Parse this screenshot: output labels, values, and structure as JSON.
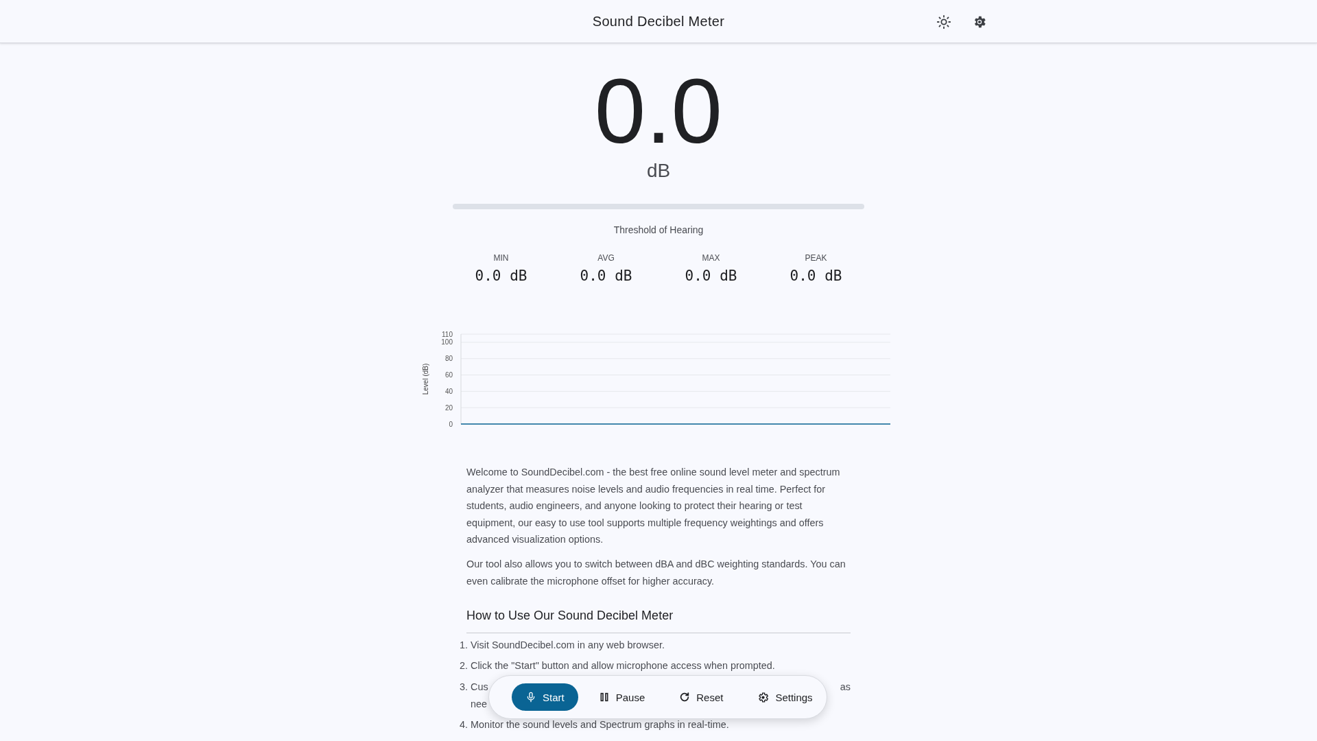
{
  "header": {
    "title": "Sound Decibel Meter"
  },
  "meter": {
    "value": "0.0",
    "unit": "dB",
    "level": 0,
    "description": "Threshold of Hearing"
  },
  "stats": [
    {
      "label": "MIN",
      "value": "0.0 dB"
    },
    {
      "label": "AVG",
      "value": "0.0 dB"
    },
    {
      "label": "MAX",
      "value": "0.0 dB"
    },
    {
      "label": "PEAK",
      "value": "0.0 dB"
    }
  ],
  "chart": {
    "chart_data": {
      "type": "line",
      "grid": true,
      "ylabel": "Level (dB)",
      "ylim": [
        0,
        110
      ],
      "yticks": [
        0,
        20,
        40,
        60,
        80,
        100,
        110
      ],
      "series": [
        {
          "color": "#0a6494",
          "values": [
            0,
            0,
            0,
            0,
            0,
            0,
            0,
            0,
            0,
            0,
            0,
            0,
            0,
            0,
            0,
            0,
            0,
            0,
            0,
            0
          ]
        }
      ]
    }
  },
  "intro": [
    "Welcome to SoundDecibel.com - the best free online sound level meter and spectrum analyzer that measures noise levels and audio frequencies in real time. Perfect for students, audio engineers, and anyone looking to protect their hearing or test equipment, our easy to use tool supports multiple frequency weightings and offers advanced visualization options.",
    "Our tool also allows you to switch between dBA and dBC weighting standards. You can even calibrate the microphone offset for higher accuracy."
  ],
  "how_to": {
    "heading": "How to Use Our Sound Decibel Meter",
    "steps": [
      {
        "number": "1.",
        "text": "Visit SoundDecibel.com in any web browser."
      },
      {
        "number": "2.",
        "text": "Click the \"Start\" button and allow microphone access when prompted."
      },
      {
        "number": "3.",
        "text": "Cus",
        "text_end": "as",
        "text_line2": "nee"
      },
      {
        "number": "4.",
        "text": "Monitor the sound levels and Spectrum graphs in real-time."
      }
    ]
  },
  "toolbar": [
    {
      "kind": "start",
      "label": "Start",
      "primary": true
    },
    {
      "kind": "pause",
      "label": "Pause",
      "primary": false
    },
    {
      "kind": "reset",
      "label": "Reset",
      "primary": false
    },
    {
      "kind": "settings",
      "label": "Settings",
      "primary": false
    }
  ]
}
